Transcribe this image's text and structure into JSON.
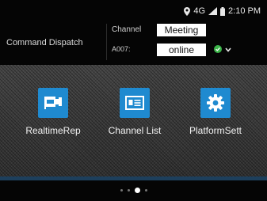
{
  "status_bar": {
    "network": "4G",
    "time": "2:10 PM"
  },
  "header": {
    "title": "Command Dispatch",
    "channel_label": "Channel",
    "channel_value": "Meeting",
    "id_label": "A007:",
    "status_value": "online"
  },
  "apps": [
    {
      "label": "RealtimeRep",
      "icon": "camera-icon"
    },
    {
      "label": "Channel List",
      "icon": "id-card-icon"
    },
    {
      "label": "PlatformSett",
      "icon": "gear-icon"
    }
  ],
  "pager": {
    "pages": 4,
    "current_page": 3
  },
  "colors": {
    "tile": "#1f8ad0",
    "online": "#3cb54a",
    "background": "#050505"
  }
}
